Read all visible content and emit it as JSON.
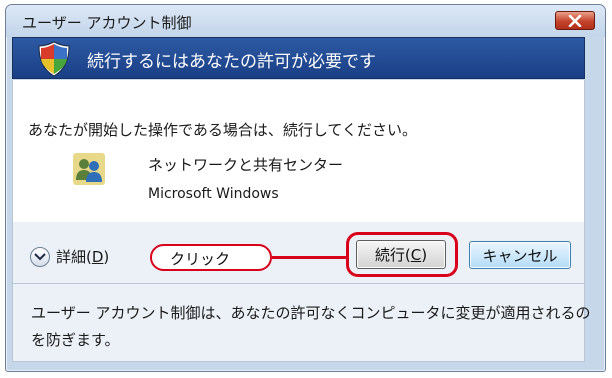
{
  "window": {
    "title": "ユーザー アカウント制御",
    "close_icon": "close-icon"
  },
  "banner": {
    "text": "続行するにはあなたの許可が必要です",
    "icon": "uac-shield-icon"
  },
  "content": {
    "instruction": "あなたが開始した操作である場合は、続行してください。",
    "program_name": "ネットワークと共有センター",
    "publisher": "Microsoft Windows",
    "program_icon": "network-sharing-center-icon"
  },
  "details": {
    "label": "詳細(",
    "accel": "D",
    "label_end": ")"
  },
  "callout": {
    "text": "クリック",
    "color": "#d8001b"
  },
  "buttons": {
    "continue_label": "続行(",
    "continue_accel": "C",
    "continue_end": ")",
    "cancel_label": "キャンセル"
  },
  "footer": {
    "text": "ユーザー アカウント制御は、あなたの許可なくコンピュータに変更が適用されるのを防ぎます。"
  }
}
